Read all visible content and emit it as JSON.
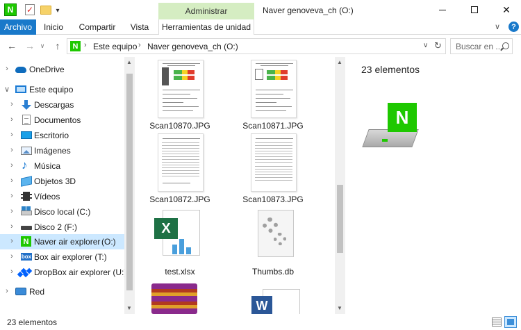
{
  "window": {
    "title": "Naver genoveva_ch (O:)",
    "contextual_tab": "Administrar"
  },
  "ribbon": {
    "tabs": [
      "Archivo",
      "Inicio",
      "Compartir",
      "Vista",
      "Herramientas de unidad"
    ]
  },
  "address": {
    "crumbs": [
      "Este equipo",
      "Naver genoveva_ch (O:)"
    ],
    "search_placeholder": "Buscar en ..."
  },
  "navigation": {
    "items": [
      {
        "label": "OneDrive",
        "icon": "onedrive-icon"
      },
      {
        "label": "Este equipo",
        "icon": "pc-icon"
      },
      {
        "label": "Descargas",
        "icon": "downloads-icon"
      },
      {
        "label": "Documentos",
        "icon": "documents-icon"
      },
      {
        "label": "Escritorio",
        "icon": "desktop-icon"
      },
      {
        "label": "Imágenes",
        "icon": "images-icon"
      },
      {
        "label": "Música",
        "icon": "music-icon"
      },
      {
        "label": "Objetos 3D",
        "icon": "3d-objects-icon"
      },
      {
        "label": "Vídeos",
        "icon": "videos-icon"
      },
      {
        "label": "Disco local (C:)",
        "icon": "local-disk-icon"
      },
      {
        "label": "Disco 2 (F:)",
        "icon": "disk-icon"
      },
      {
        "label": "Naver air explorer",
        "drive": "(O:)",
        "icon": "naver-icon",
        "selected": true
      },
      {
        "label": "Box air explorer (T:)",
        "icon": "box-icon"
      },
      {
        "label": "DropBox air explorer (U:)",
        "icon": "dropbox-icon"
      },
      {
        "label": "Red",
        "icon": "network-icon"
      }
    ]
  },
  "files": [
    {
      "name": "Scan10870.JPG",
      "kind": "scan-report"
    },
    {
      "name": "Scan10871.JPG",
      "kind": "scan-report"
    },
    {
      "name": "Scan10872.JPG",
      "kind": "scan-text"
    },
    {
      "name": "Scan10873.JPG",
      "kind": "scan-table"
    },
    {
      "name": "test.xlsx",
      "kind": "excel-icon"
    },
    {
      "name": "Thumbs.db",
      "kind": "system-file-icon"
    },
    {
      "name": "",
      "kind": "winrar-icon"
    },
    {
      "name": "",
      "kind": "word-icon"
    }
  ],
  "preview": {
    "count_text": "23 elementos"
  },
  "status": {
    "count_text": "23 elementos"
  },
  "colors": {
    "accent": "#1979ca",
    "naver_green": "#1ec800",
    "contextual_tab_bg": "#d5edc2",
    "selection": "#cce8ff"
  }
}
